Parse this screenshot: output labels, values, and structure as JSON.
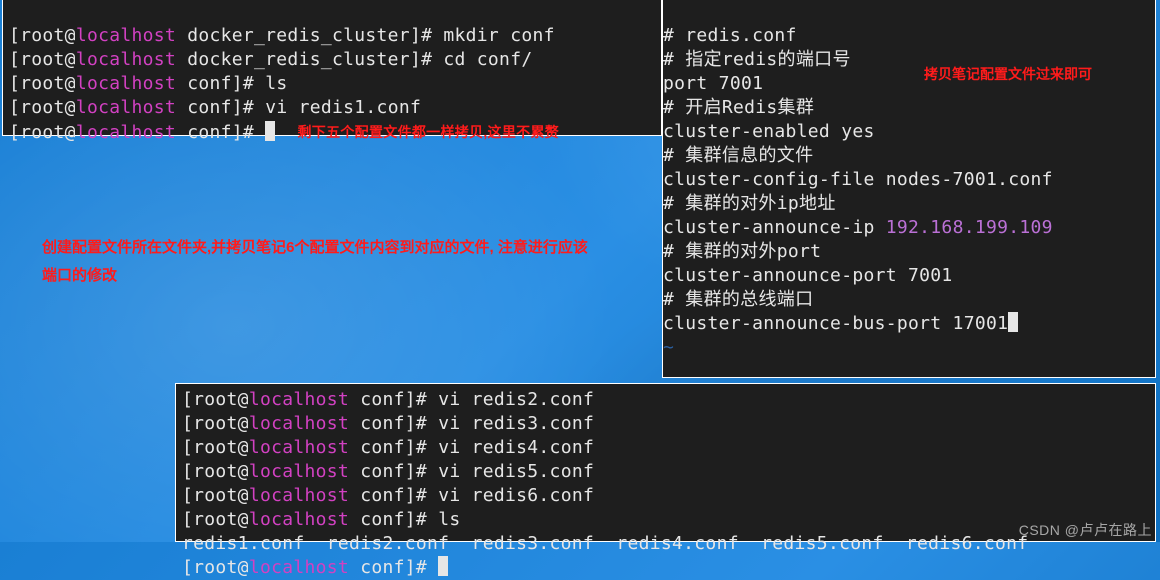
{
  "terminal_top_left": {
    "lines": [
      {
        "prompt_host": "localhost",
        "prompt_dir": "docker_redis_cluster",
        "cmd": "mkdir conf"
      },
      {
        "prompt_host": "localhost",
        "prompt_dir": "docker_redis_cluster",
        "cmd": "cd conf/"
      },
      {
        "prompt_host": "localhost",
        "prompt_dir": "conf",
        "cmd": "ls"
      },
      {
        "prompt_host": "localhost",
        "prompt_dir": "conf",
        "cmd": "vi redis1.conf"
      },
      {
        "prompt_host": "localhost",
        "prompt_dir": "conf",
        "cmd": "",
        "inline_note": "剩下五个配置文件都一样拷贝,这里不累赘"
      }
    ]
  },
  "terminal_right": {
    "lines": [
      "# redis.conf",
      "# 指定redis的端口号",
      "port 7001",
      "# 开启Redis集群",
      "cluster-enabled yes",
      "# 集群信息的文件",
      "cluster-config-file nodes-7001.conf",
      "# 集群的对外ip地址",
      "cluster-announce-ip 192.168.199.109",
      "# 集群的对外port",
      "cluster-announce-port 7001",
      "# 集群的总线端口",
      "cluster-announce-bus-port 17001"
    ],
    "ip_value": "192.168.199.109"
  },
  "terminal_bottom": {
    "prompts": [
      {
        "host": "localhost",
        "dir": "conf",
        "cmd": "vi redis2.conf"
      },
      {
        "host": "localhost",
        "dir": "conf",
        "cmd": "vi redis3.conf"
      },
      {
        "host": "localhost",
        "dir": "conf",
        "cmd": "vi redis4.conf"
      },
      {
        "host": "localhost",
        "dir": "conf",
        "cmd": "vi redis5.conf"
      },
      {
        "host": "localhost",
        "dir": "conf",
        "cmd": "vi redis6.conf"
      },
      {
        "host": "localhost",
        "dir": "conf",
        "cmd": "ls"
      }
    ],
    "ls_output": "redis1.conf  redis2.conf  redis3.conf  redis4.conf  redis5.conf  redis6.conf",
    "final_prompt": {
      "host": "localhost",
      "dir": "conf"
    }
  },
  "annotations": {
    "left_note": "创建配置文件所在文件夹,并拷贝笔记6个配置文件内容到对应的文件,\n注意进行应该端口的修改",
    "right_note": "拷贝笔记配置文件过来即可"
  },
  "watermark": "CSDN @卢卢在路上"
}
